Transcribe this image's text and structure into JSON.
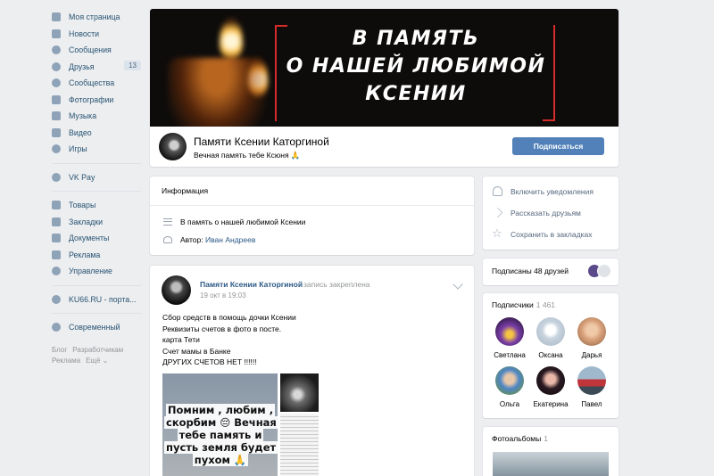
{
  "sidebar": {
    "items": [
      {
        "label": "Моя страница",
        "icon": "home-icon"
      },
      {
        "label": "Новости",
        "icon": "news-icon"
      },
      {
        "label": "Сообщения",
        "icon": "messages-icon"
      },
      {
        "label": "Друзья",
        "icon": "friends-icon",
        "count": "13"
      },
      {
        "label": "Сообщества",
        "icon": "communities-icon"
      },
      {
        "label": "Фотографии",
        "icon": "camera-icon"
      },
      {
        "label": "Музыка",
        "icon": "music-icon"
      },
      {
        "label": "Видео",
        "icon": "video-icon"
      },
      {
        "label": "Игры",
        "icon": "games-icon"
      }
    ],
    "vkpay": {
      "label": "VK Pay",
      "icon": "vkpay-icon"
    },
    "group2": [
      {
        "label": "Товары",
        "icon": "goods-icon"
      },
      {
        "label": "Закладки",
        "icon": "bookmarks-icon"
      },
      {
        "label": "Документы",
        "icon": "documents-icon"
      },
      {
        "label": "Реклама",
        "icon": "ads-icon"
      },
      {
        "label": "Управление",
        "icon": "manage-icon"
      }
    ],
    "ku66": {
      "label": "KU66.RU - порта...",
      "icon": "globe-icon"
    },
    "modern": {
      "label": "Современный",
      "icon": "chat-icon"
    },
    "footer": {
      "blog": "Блог",
      "devs": "Разработчикам",
      "ads": "Реклама",
      "more": "Ещё ⌄"
    }
  },
  "cover": {
    "line1": "в память",
    "line2": "о нашей любимой",
    "line3": "Ксении"
  },
  "page": {
    "title": "Памяти Ксении Каторгиной",
    "status": "Вечная память тебе Ксюня 🙏",
    "subscribe_label": "Подписаться"
  },
  "info": {
    "heading": "Информация",
    "description": "В память о нашей любимой Ксении",
    "author_prefix": "Автор:",
    "author_name": "Иван Андреев"
  },
  "post": {
    "author": "Памяти Ксении Каторгиной",
    "pinned": "запись закреплена",
    "date": "19 окт в 19:03",
    "lines": [
      "Сбор средств в помощь дочки Ксении",
      "Реквизиты счетов в фото в посте.",
      "карта Тети",
      "Счет мамы в Банке",
      "ДРУГИХ СЧЕТОВ НЕТ !!!!!!"
    ],
    "photo_text": "Помним , любим , скорбим 😔 Вечная тебе память и пусть земля будет пухом 🙏"
  },
  "actions": [
    {
      "label": "Включить уведомления",
      "icon": "bell-icon"
    },
    {
      "label": "Рассказать друзьям",
      "icon": "share-arrow-icon"
    },
    {
      "label": "Сохранить в закладках",
      "icon": "star-icon"
    }
  ],
  "friends": {
    "label": "Подписаны 48 друзей"
  },
  "subscribers": {
    "heading": "Подписчики",
    "count": "1 461",
    "people": [
      {
        "name": "Светлана",
        "color": "#7a3fa8"
      },
      {
        "name": "Оксана",
        "color": "#c7d3dd"
      },
      {
        "name": "Дарья",
        "color": "#d9a27c"
      },
      {
        "name": "Ольга",
        "color": "#4f86c6"
      },
      {
        "name": "Екатерина",
        "color": "#2a1a22"
      },
      {
        "name": "Павел",
        "color": "#c0353a"
      }
    ]
  },
  "albums": {
    "heading": "Фотоальбомы",
    "count": "1"
  },
  "colors": {
    "accent": "#5181b8",
    "link": "#2a5885",
    "background": "#edeef0",
    "frame": "#d52b2b"
  }
}
